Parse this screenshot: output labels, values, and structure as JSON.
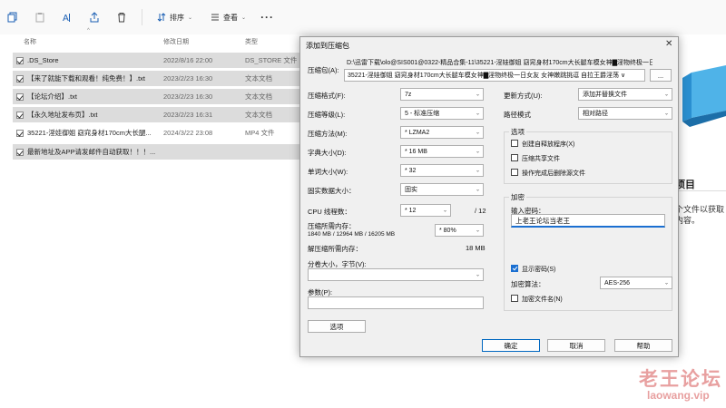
{
  "toolbar": {
    "sort_label": "排序",
    "view_label": "查看",
    "more_label": "···"
  },
  "columns": {
    "name": "名称",
    "date": "修改日期",
    "type": "类型"
  },
  "files": [
    {
      "name": ".DS_Store",
      "date": "2022/8/16 22:00",
      "type": "DS_STORE 文件",
      "checked": true,
      "selected": true,
      "kind": "file"
    },
    {
      "name": "【来了就能下载和观看！纯免费！】.txt",
      "date": "2023/2/23 16:30",
      "type": "文本文档",
      "checked": true,
      "selected": true,
      "kind": "txt"
    },
    {
      "name": "【论坛介绍】.txt",
      "date": "2023/2/23 16:30",
      "type": "文本文档",
      "checked": true,
      "selected": true,
      "kind": "txt"
    },
    {
      "name": "【永久地址发布页】.txt",
      "date": "2023/2/23 16:31",
      "type": "文本文档",
      "checked": true,
      "selected": true,
      "kind": "txt"
    },
    {
      "name": "35221-淫娃御姐 窈窕身材170cm大长腿...",
      "date": "2024/3/22 23:08",
      "type": "MP4 文件",
      "checked": true,
      "selected": false,
      "kind": "mp4"
    },
    {
      "name": "最新地址及APP请发邮件自动获取！！！...",
      "date": "2023/2/23 16:31",
      "type": "文本文档",
      "checked": true,
      "selected": true,
      "kind": "txt"
    }
  ],
  "right_panel": {
    "title_partial": "项目",
    "text_line1": "个文件以获取",
    "text_line2": "内容。"
  },
  "watermark": {
    "line1": "老王论坛",
    "line2": "laowang.vip"
  },
  "dialog": {
    "title": "添加到压缩包",
    "close": "✕",
    "archive_label": "压缩包(A):",
    "archive_path_line1": "D:\\迅雷下载\\olo@SIS001@0322-精品合集-11\\35221-淫娃御姐 窈窕身材170cm大长腿车模女神▇淫物终极一日女友",
    "archive_path_line2": "35221-淫娃御姐 窈窕身材170cm大长腿车模女神▇淫物终极一日女友 女神嫩跳挑逗 自拉王爵淫荡 ∨",
    "browse_button": "...",
    "format_label": "压缩格式(F):",
    "format_value": "7z",
    "level_label": "压缩等级(L):",
    "level_value": "5 - 标准压缩",
    "method_label": "压缩方法(M):",
    "method_value": "* LZMA2",
    "dict_label": "字典大小(D):",
    "dict_value": "* 16 MB",
    "word_label": "单词大小(W):",
    "word_value": "* 32",
    "solid_label": "固实数据大小：",
    "solid_value": "固实",
    "cpu_label": "CPU 线程数：",
    "cpu_value": "* 12",
    "cpu_total": "/ 12",
    "mem_label": "压缩所需内存：",
    "mem_detail": "1840 MB / 12964 MB / 16205 MB",
    "mem_value": "* 80%",
    "decomp_label": "解压缩所需内存：",
    "decomp_value": "18 MB",
    "split_label": "分卷大小，字节(V):",
    "split_value": "",
    "params_label": "参数(P):",
    "params_value": "",
    "options_button": "选项",
    "update_label": "更新方式(U):",
    "update_value": "添加并替换文件",
    "path_label": "路径模式",
    "path_value": "相对路径",
    "options_group": "选项",
    "opt_sfx": "创建自释放程序(X)",
    "opt_shared": "压缩共享文件",
    "opt_delete": "操作完成后删除源文件",
    "encrypt_group": "加密",
    "pwd_label": "输入密码：",
    "pwd_value": "上老王论坛当老王",
    "show_pwd": "显示密码(S)",
    "enc_method_label": "加密算法：",
    "enc_method_value": "AES-256",
    "enc_names": "加密文件名(N)",
    "ok_button": "确定",
    "cancel_button": "取消",
    "help_button": "帮助"
  }
}
